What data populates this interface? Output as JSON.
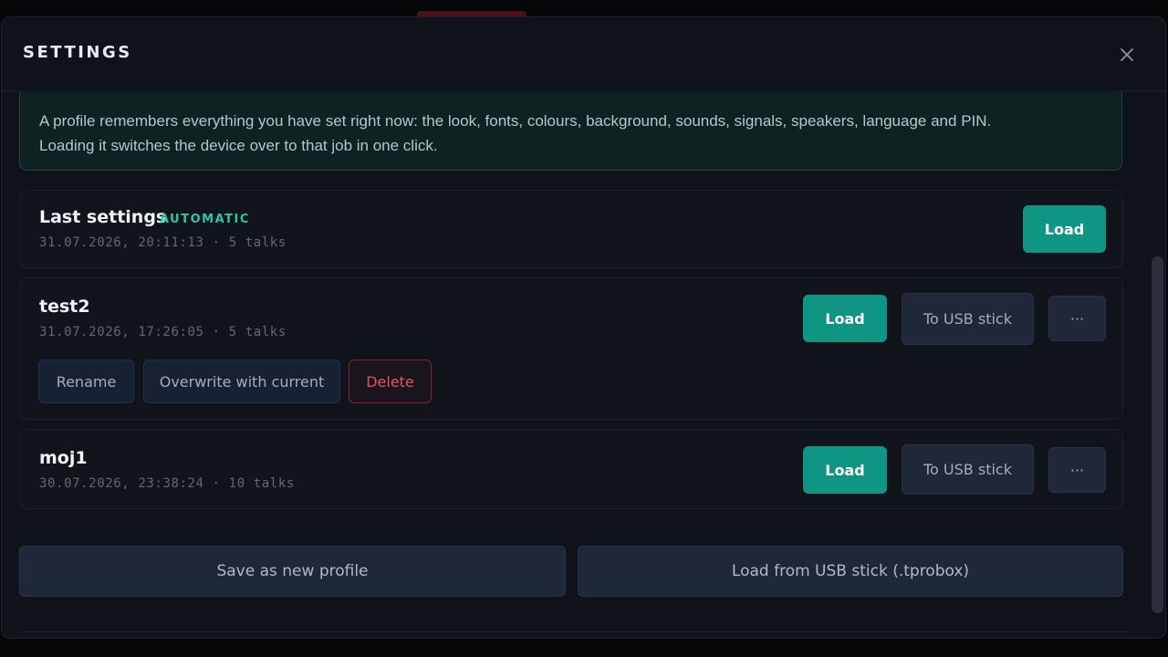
{
  "dialog": {
    "title": "SETTINGS",
    "close_icon": "close-icon"
  },
  "info": {
    "text_line1": "A profile remembers everything you have set right now: the look, fonts, colours, background, sounds, signals, speakers, language and PIN.",
    "text_line2": "Loading it switches the device over to that job in one click."
  },
  "profiles": [
    {
      "name": "Last settings",
      "badge": "AUTOMATIC",
      "meta": "31.07.2026, 20:11:13 · 5 talks",
      "load_label": "Load"
    },
    {
      "name": "test2",
      "meta": "31.07.2026, 17:26:05 · 5 talks",
      "load_label": "Load",
      "usb_label": "To USB stick",
      "more_label": "···",
      "rename_label": "Rename",
      "overwrite_label": "Overwrite with current",
      "delete_label": "Delete"
    },
    {
      "name": "moj1",
      "meta": "30.07.2026, 23:38:24 · 10 talks",
      "load_label": "Load",
      "usb_label": "To USB stick",
      "more_label": "···"
    }
  ],
  "actions": {
    "save_new_label": "Save as new profile",
    "load_usb_label": "Load from USB stick (.tprobox)"
  },
  "colors": {
    "accent": "#0f9583",
    "badge": "#2cc5ab",
    "danger": "#e25561",
    "background": "#0f1218"
  }
}
